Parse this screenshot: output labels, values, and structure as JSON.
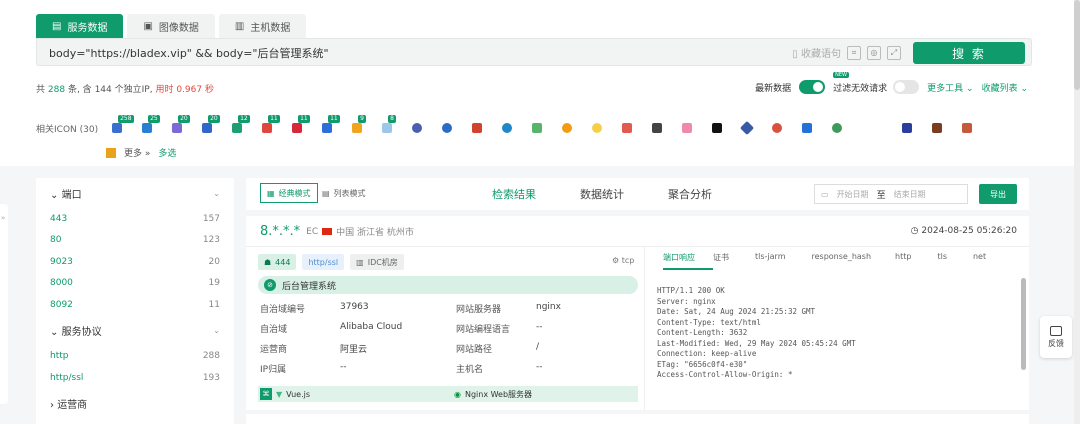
{
  "tabs": [
    {
      "label": "服务数据",
      "icon": "list-icon",
      "active": true
    },
    {
      "label": "图像数据",
      "icon": "image-icon",
      "active": false
    },
    {
      "label": "主机数据",
      "icon": "host-icon",
      "active": false
    }
  ],
  "search": {
    "query": "body=\"https://bladex.vip\" && body=\"后台管理系统\"",
    "save_label": "收藏语句",
    "button_label": "搜 索"
  },
  "result_meta": {
    "prefix": "共",
    "total": "288",
    "unit1": "条, 含",
    "ip_count": "144",
    "unit2": "个独立IP,",
    "time_label": "用时 0.967 秒"
  },
  "options": {
    "latest_label": "最新数据",
    "new_badge": "NEW",
    "filter_label": "过滤无效请求",
    "more_tools": "更多工具",
    "collect_list": "收藏列表"
  },
  "icons": {
    "label": "相关ICON (30)",
    "counts": [
      "258",
      "25",
      "20",
      "20",
      "12",
      "11",
      "11",
      "11",
      "9",
      "8"
    ],
    "more_label": "更多",
    "multi_label": "多选"
  },
  "filters": [
    {
      "title": "端口",
      "items": [
        {
          "k": "443",
          "v": "157"
        },
        {
          "k": "80",
          "v": "123"
        },
        {
          "k": "9023",
          "v": "20"
        },
        {
          "k": "8000",
          "v": "19"
        },
        {
          "k": "8092",
          "v": "11"
        }
      ]
    },
    {
      "title": "服务协议",
      "items": [
        {
          "k": "http",
          "v": "288"
        },
        {
          "k": "http/ssl",
          "v": "193"
        }
      ]
    },
    {
      "title": "运营商",
      "items": []
    }
  ],
  "main": {
    "mode_classic": "经典模式",
    "mode_list": "列表模式",
    "tabs": [
      "检索结果",
      "数据统计",
      "聚合分析"
    ],
    "date_start": "开始日期",
    "date_to": "至",
    "date_end": "结束日期",
    "export_label": "导出"
  },
  "card": {
    "ip": "8.*.*.*",
    "ec": "EC",
    "geo": "中国 浙江省 杭州市",
    "time": "2024-08-25 05:26:20",
    "port": "444",
    "proto": "http/ssl",
    "idc": "IDC机房",
    "transport": "tcp",
    "title": "后台管理系统",
    "info": [
      {
        "l1": "自治域编号",
        "v1": "37963",
        "l2": "网站服务器",
        "v2": "nginx"
      },
      {
        "l1": "自治域",
        "v1": "Alibaba Cloud",
        "l2": "网站编程语言",
        "v2": "--"
      },
      {
        "l1": "运营商",
        "v1": "阿里云",
        "l2": "网站路径",
        "v2": "/"
      },
      {
        "l1": "IP归属",
        "v1": "--",
        "l2": "主机名",
        "v2": "--"
      }
    ],
    "tech1": "Vue.js",
    "tech2": "Nginx Web服务器",
    "resp_tabs": [
      "端口响应",
      "证书",
      "tls-jarm",
      "response_hash",
      "http",
      "tls",
      "net"
    ],
    "response": "HTTP/1.1 200 OK\nServer: nginx\nDate: Sat, 24 Aug 2024 21:25:32 GMT\nContent-Type: text/html\nContent-Length: 3632\nLast-Modified: Wed, 29 May 2024 05:45:24 GMT\nConnection: keep-alive\nETag: \"6656c0f4-e30\"\nAccess-Control-Allow-Origin: *"
  },
  "feedback_label": "反馈",
  "colors": {
    "accent": "#0f9b6b",
    "danger": "#e04a3a"
  }
}
